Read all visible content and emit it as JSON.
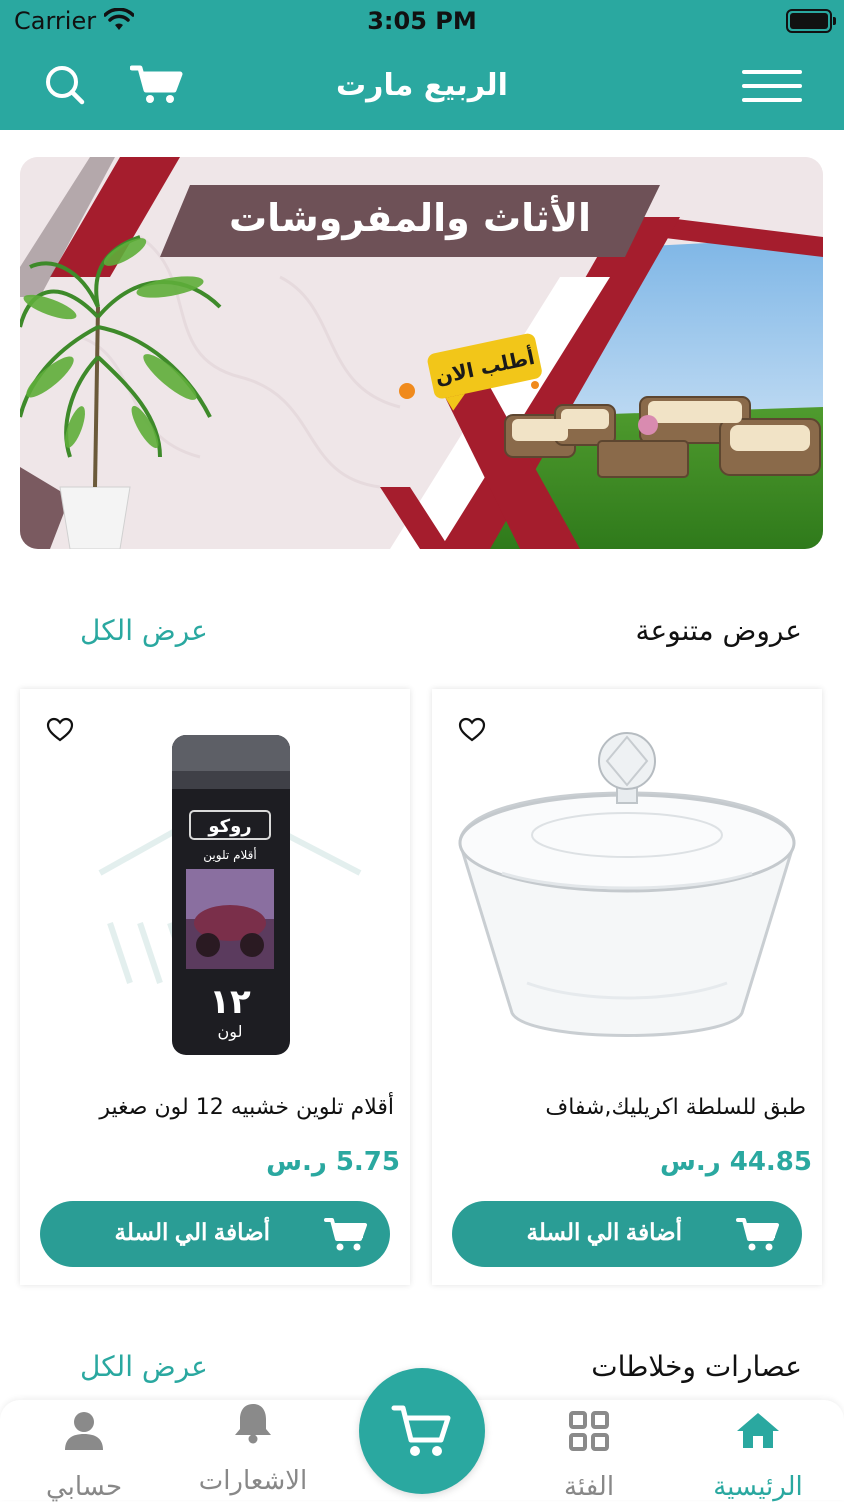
{
  "status_bar": {
    "carrier": "Carrier",
    "time": "3:05 PM"
  },
  "header": {
    "title": "الربيع مارت"
  },
  "banner": {
    "headline": "الأثاث والمفروشات",
    "cta": "أطلب الان"
  },
  "sections": [
    {
      "title": "عروض متنوعة",
      "see_all": "عرض الكل"
    },
    {
      "title": "عصارات وخلاطات",
      "see_all": "عرض الكل"
    }
  ],
  "products": [
    {
      "name": "طبق للسلطة اكريليك,شفاف",
      "price": "44.85 ر.س",
      "add_to_cart": "أضافة الي السلة",
      "image": "glass-bowl"
    },
    {
      "name": "أقلام تلوين خشبيه 12 لون صغير",
      "price": "5.75 ر.س",
      "add_to_cart": "أضافة الي السلة",
      "image": "colored-pencils-tube",
      "tube_brand": "روكو",
      "tube_sub": "أقلام تلوين",
      "tube_count": "١٢",
      "tube_unit": "لون"
    }
  ],
  "tabbar": {
    "items": [
      {
        "label": "الرئيسية",
        "icon": "home-icon",
        "active": true
      },
      {
        "label": "الفئة",
        "icon": "grid-icon",
        "active": false
      },
      {
        "label": "الاشعارات",
        "icon": "bell-icon",
        "active": false
      },
      {
        "label": "حسابي",
        "icon": "user-icon",
        "active": false
      }
    ]
  },
  "colors": {
    "brand": "#2aa8a0",
    "button": "#2a9d95",
    "banner_red": "#a51d2d"
  }
}
